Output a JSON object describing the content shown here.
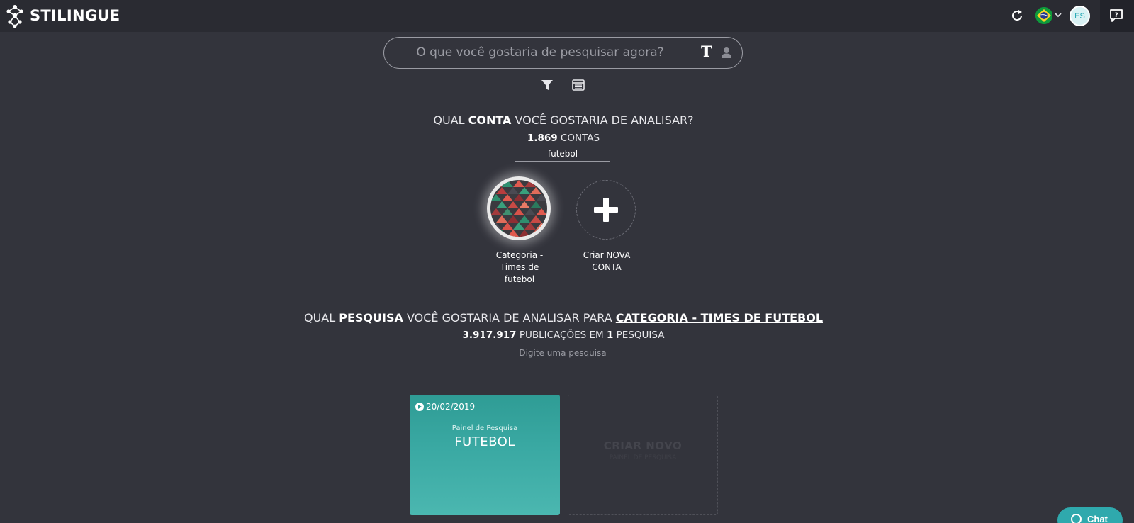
{
  "header": {
    "logo_text": "STILINGUE",
    "avatar_initials": "ES",
    "flag": "brazil-flag",
    "icons": [
      "logo-icon",
      "refresh-icon",
      "brazil-flag-icon",
      "chevron-down-icon",
      "help-chat-icon"
    ]
  },
  "search": {
    "placeholder": "O que você gostaria de pesquisar agora?",
    "text_mode_glyph": "T",
    "icons": [
      "user-icon",
      "filter-icon",
      "table-icon"
    ]
  },
  "accounts_section": {
    "question_pre": "QUAL ",
    "question_bold": "CONTA",
    "question_post": " VOCÊ GOSTARIA DE ANALISAR?",
    "count_value": "1.869",
    "count_label": " CONTAS",
    "filter_value": "futebol",
    "accounts": [
      {
        "label": "Categoria - Times de futebol"
      }
    ],
    "new_account_label": "Criar NOVA CONTA"
  },
  "searches_section": {
    "question_pre": "QUAL ",
    "question_bold": "PESQUISA",
    "question_mid": " VOCÊ GOSTARIA DE ANALISAR PARA ",
    "question_link": "CATEGORIA - TIMES DE FUTEBOL",
    "count_value": "3.917.917",
    "count_mid": " PUBLICAÇÕES EM ",
    "count_value2": "1",
    "count_label": " PESQUISA",
    "search_placeholder": "Digite uma pesquisa",
    "cards": [
      {
        "date": "20/02/2019",
        "subtitle": "Painel de Pesquisa",
        "title": "FUTEBOL"
      }
    ],
    "new_card_title": "CRIAR NOVO",
    "new_card_subtitle": "PAINEL DE PESQUISA"
  },
  "chat": {
    "label": "Chat"
  },
  "colors": {
    "background": "#33343c",
    "topbar": "#2a2b32",
    "card_teal": "#3aa9a3",
    "chat_accent": "#2fa9ad"
  }
}
